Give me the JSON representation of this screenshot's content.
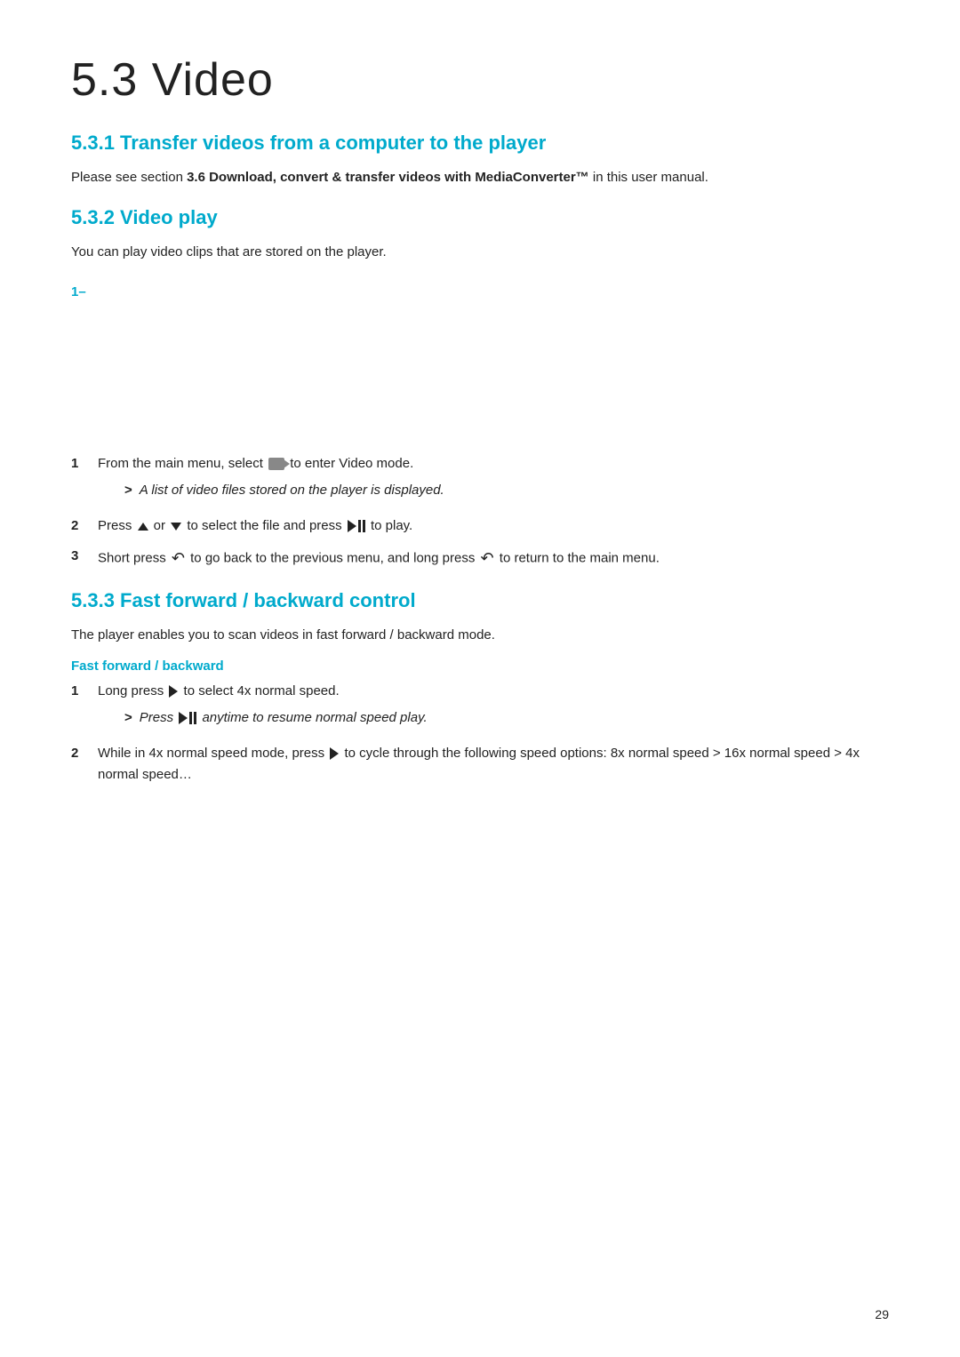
{
  "page": {
    "number": "29"
  },
  "section": {
    "title": "5.3  Video",
    "subsections": [
      {
        "id": "5.3.1",
        "title": "5.3.1  Transfer videos from a computer to the player",
        "body": "Please see section ",
        "bold_part": "3.6 Download, convert & transfer videos with MediaConverter™",
        "body_end": " in this user manual."
      },
      {
        "id": "5.3.2",
        "title": "5.3.2  Video play",
        "intro": "You can play video clips that are stored on the player.",
        "diagram_label": "1–",
        "steps": [
          {
            "num": "1",
            "text_before": "From the main menu, select ",
            "icon": "video-icon",
            "text_after": " to enter Video mode.",
            "sub": "A list of video files stored on the player is displayed."
          },
          {
            "num": "2",
            "text_before": "Press ",
            "icon1": "up-icon",
            "text_mid1": " or ",
            "icon2": "down-icon",
            "text_mid2": " to select the file and press ",
            "icon3": "play-pause-icon",
            "text_after": " to play."
          },
          {
            "num": "3",
            "text_before": "Short press ",
            "icon1": "back-icon",
            "text_mid1": " to go back to the previous menu, and long press ",
            "icon2": "back-icon",
            "text_after": " to return to the main menu."
          }
        ]
      },
      {
        "id": "5.3.3",
        "title": "5.3.3  Fast forward / backward control",
        "intro": "The player enables you to scan videos in fast forward / backward mode.",
        "subheading": "Fast forward / backward",
        "steps": [
          {
            "num": "1",
            "text_before": "Long press ",
            "icon1": "play-icon",
            "text_after": " to select 4x normal speed.",
            "sub": "Press ",
            "sub_icon": "play-pause-icon",
            "sub_after": " anytime to resume normal speed play."
          },
          {
            "num": "2",
            "text_before": "While in 4x normal speed mode, press ",
            "icon1": "play-icon",
            "text_after": " to cycle through the following speed options: 8x normal speed > 16x normal speed > 4x normal speed…"
          }
        ]
      }
    ]
  }
}
